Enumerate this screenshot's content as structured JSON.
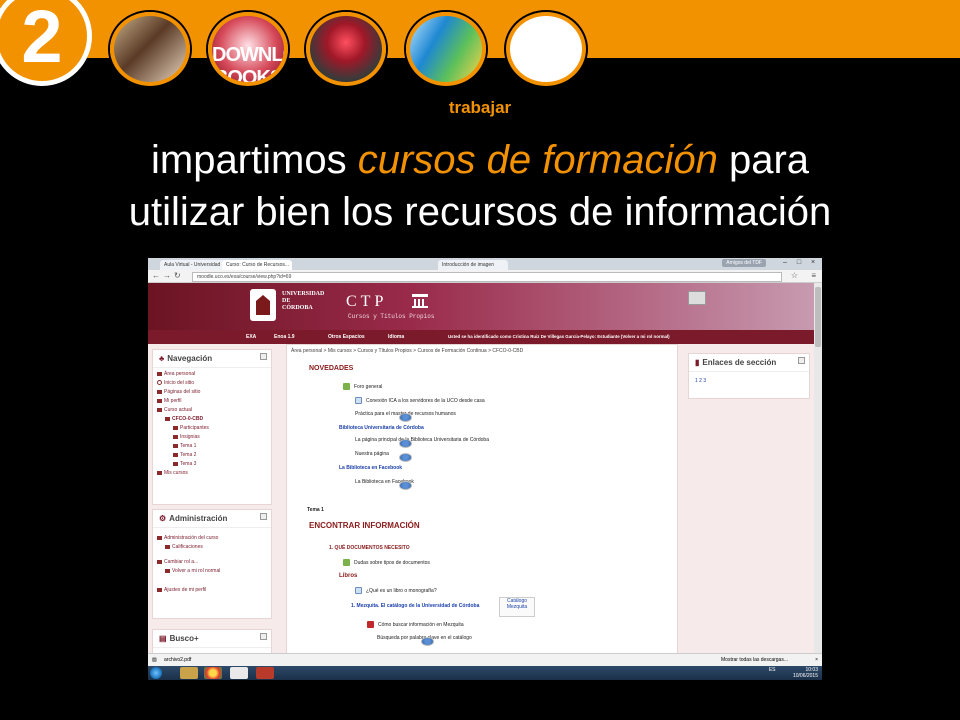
{
  "header": {
    "number": "2",
    "thumb_label_2": "DOWNLOAD BOOKS",
    "keyword": "trabajar",
    "headline_part1": "impartimos ",
    "headline_em": "cursos de formación",
    "headline_part2": " para",
    "headline_line2": "utilizar bien los recursos de información",
    "accent_color": "#f39200"
  },
  "browser": {
    "tabs": [
      "Aula Virtual - Universidad",
      "Curso: Curso de Recursos...",
      "Introducción de imagen"
    ],
    "user_chip": "Amigos del TDF",
    "url": "moodle.uco.es/exa/course/view.php?id=69"
  },
  "site": {
    "university": "UNIVERSIDAD\nDE\nCÓRDOBA",
    "ctp_title": "CTP",
    "ctp_subtitle": "Cursos y Títulos Propios",
    "menu": {
      "exa": "EXA",
      "enoa": "Enoa 1.9",
      "otros": "Otros Espacios",
      "idioma": "Idioma",
      "identified": "Usted se ha identificado como Cristina Ruiz De Villegas García-Pelayo: Estudiante (Volver a mi rol normal)"
    },
    "navigation": {
      "title": "Navegación",
      "items": [
        "Área personal",
        "Inicio del sitio",
        "Páginas del sitio",
        "Mi perfil",
        "Curso actual",
        "CFCO-0-CBD",
        "Participantes",
        "Insignias",
        "Tema 1",
        "Tema 2",
        "Tema 3",
        "Mis cursos"
      ]
    },
    "admin": {
      "title": "Administración",
      "items": [
        "Administración del curso",
        "Calificaciones",
        "Cambiar rol a...",
        "Volver a mi rol normal",
        "Ajustes de mi perfil"
      ]
    },
    "busco": {
      "title": "Busco+"
    },
    "breadcrumb": "Área personal  >  Mis cursos  >  Cursos y Títulos Propios  >  Cursos de Formación Continua  >  CFCO-0-CBD",
    "novedades": "NOVEDADES",
    "rows": [
      "Foro general",
      "Conexión ICA a los servidores de la UCO desde casa",
      "Práctica para el master de recursos humanos",
      "Biblioteca Universitaria de Córdoba",
      "La página principal de la Biblioteca Universitaria de Córdoba",
      "Nuestra página",
      "La Biblioteca en Facebook",
      "La Biblioteca en Facebook"
    ],
    "tema1": "Tema 1",
    "encontrar": "ENCONTRAR INFORMACIÓN",
    "q1": "1. QUÉ DOCUMENTOS NECESITO",
    "dudas": "Dudas sobre tipos de documentos",
    "libros": "Libros",
    "que_es": "¿Qué es un libro o monografía?",
    "mezquita": "1. Mezquita. El catálogo de la Universidad de Córdoba",
    "catalogo_img": "Catálogo Mezquita",
    "como_buscar": "Cómo buscar información en Mezquita",
    "busqueda": "Búsqueda por palabra clave en el catálogo",
    "enlaces": {
      "title": "Enlaces de sección",
      "items": "1 2 3"
    }
  },
  "downloads": {
    "file": "archivo2.pdf",
    "show_all": "Mostrar todas las descargas..."
  },
  "taskbar": {
    "lang": "ES",
    "time": "10:03",
    "date": "10/06/2015"
  }
}
